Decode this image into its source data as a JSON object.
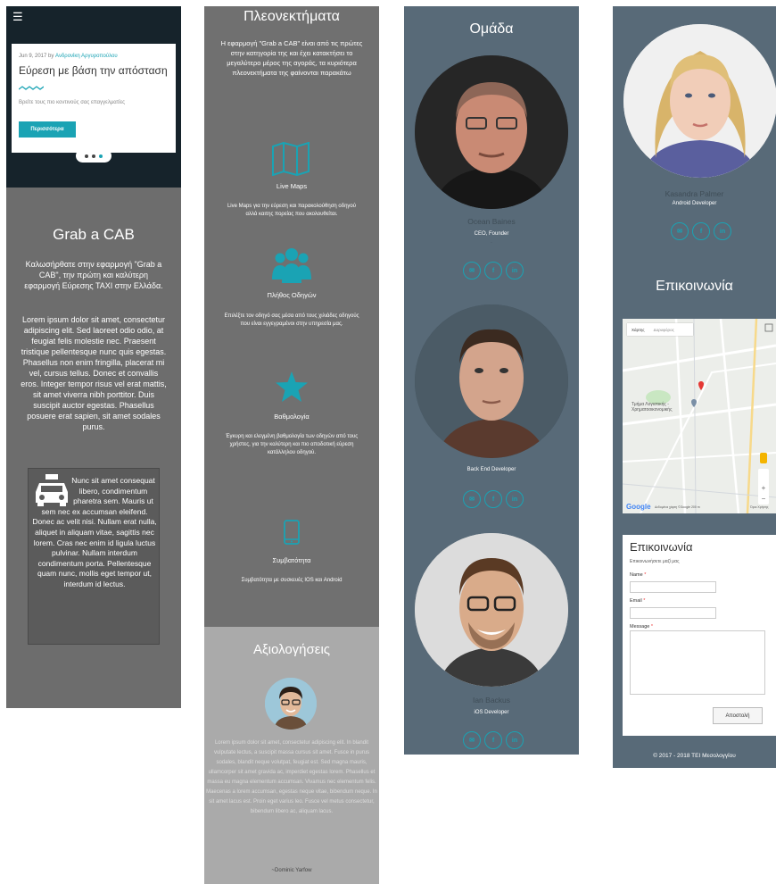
{
  "col1": {
    "menu_icon": "☰",
    "card": {
      "date": "Jun 9, 2017 by",
      "author": "Ανδρονίκη Αργυροπούλου",
      "title": "Εύρεση με βάση την απόσταση",
      "desc": "Βρείτε τους πιο κοντινούς σας επαγγελματίες",
      "button": "Περισσότερα"
    },
    "title": "Grab a CAB",
    "intro": "Καλωσήρθατε στην εφαρμογή \"Grab a CAB\", την πρώτη και καλύτερη εφαρμογή Εύρεσης ΤΑΧΙ στην Ελλάδα.",
    "lorem": "Lorem ipsum dolor sit amet, consectetur adipiscing elit. Sed laoreet odio odio, at feugiat felis molestie nec. Praesent tristique pellentesque nunc quis egestas. Phasellus non enim fringilla, placerat mi vel, cursus tellus. Donec et convallis eros. Integer tempor risus vel erat mattis, sit amet viverra nibh porttitor. Duis suscipit auctor egestas. Phasellus posuere erat sapien, sit amet sodales purus.",
    "box_text": "Nunc sit amet consequat libero, condimentum pharetra sem. Mauris ut sem nec ex accumsan eleifend. Donec ac velit nisi. Nullam erat nulla, aliquet in aliquam vitae, sagittis nec lorem. Cras nec enim id ligula luctus pulvinar. Nullam interdum condimentum porta. Pellentesque quam nunc, mollis eget tempor ut, interdum id lectus."
  },
  "col2": {
    "title": "Πλεονεκτήματα",
    "intro": "Η εφαρμογή \"Grab a CAB\" είναι από τις πρώτες στην κατηγορία της και έχει κατακτήσει το μεγαλύτερο μέρος της αγοράς, τα κυριότερα πλεονεκτήματα της φαίνονται παρακάτω",
    "features": [
      {
        "icon": "map-icon",
        "title": "Live Maps",
        "desc": "Live Maps για την εύρεση και παρακολούθηση οδηγού αλλά καιτης πορείας που ακολουθείται."
      },
      {
        "icon": "users-icon",
        "title": "Πλήθος Οδηγών",
        "desc": "Επιλέξτε τον οδηγό σας μέσα από τους χιλιάδες οδηγούς που είναι εγγεγραμένοι στην υπηρεσία μας."
      },
      {
        "icon": "star-icon",
        "title": "Βαθμολογία",
        "desc": "Έγκυρη και ελεγμένη βαθμολογία των οδηγών από τους χρήστες, για την καλύτερη και πιο αποδοτική εύρεση κατάλληλου οδηγού."
      },
      {
        "icon": "mobile-icon",
        "title": "Συμβατότητα",
        "desc": "Συμβατότητα με συσκευές IOS και Android"
      }
    ],
    "reviews": {
      "title": "Αξιολογήσεις",
      "text": "Lorem ipsum dolor sit amet, consectetur adipiscing elit. In blandit vulputate lectus, a suscipit massa cursus sit amet. Fusce in purus sodales, blandit neque volutpat, feugiat est. Sed magna mauris, ullamcorper sit amet gravida ac, imperdiet egestas lorem. Phasellus et massa eu magna elementum accumsan. Vivamus nec elementum felis. Maecenas a lorem accumsan, egestas neque vitae, bibendum neque. In sit amet lacus est. Proin eget varius leo. Fusce vel metus consectetur, bibendum libero ac, aliquam lacus.",
      "author": "~Dominic Yarfow"
    }
  },
  "col3": {
    "title": "Ομάδα",
    "members": [
      {
        "name": "Ocean Baines",
        "role": "CEO, Founder",
        "extra": "."
      },
      {
        "name": "",
        "role": "Back End Developer"
      },
      {
        "name": "Ian Backus",
        "role": "iOS Developer"
      }
    ]
  },
  "col4": {
    "member": {
      "name": "Kasandra Palmer",
      "role": "Android Developer"
    },
    "contact_title": "Επικοινωνία",
    "map": {
      "tab_map": "Χάρτης",
      "tab_sat": "Δορυφόρος",
      "place": "Τμήμα Λογιστικής - Χρηματοοικονομικής",
      "google": "Google",
      "footer": "Δεδομένα χάρτη ©Google   200 m",
      "terms": "Όροι Χρήσης"
    },
    "form": {
      "title": "Επικοινωνία",
      "subtitle": "Επικοινωνήσετε μαζί μας",
      "name_label": "Name",
      "email_label": "Email",
      "message_label": "Message",
      "required": "*",
      "submit": "Αποστολή"
    },
    "footer": "© 2017 - 2018 ΤΕΙ Μεσολογγίου"
  },
  "social": {
    "email": "✉",
    "facebook": "f",
    "linkedin": "in"
  },
  "colors": {
    "accent": "#1aa3b4",
    "slate": "#586a78",
    "gray": "#6d6d6d",
    "navy": "#16232b"
  }
}
